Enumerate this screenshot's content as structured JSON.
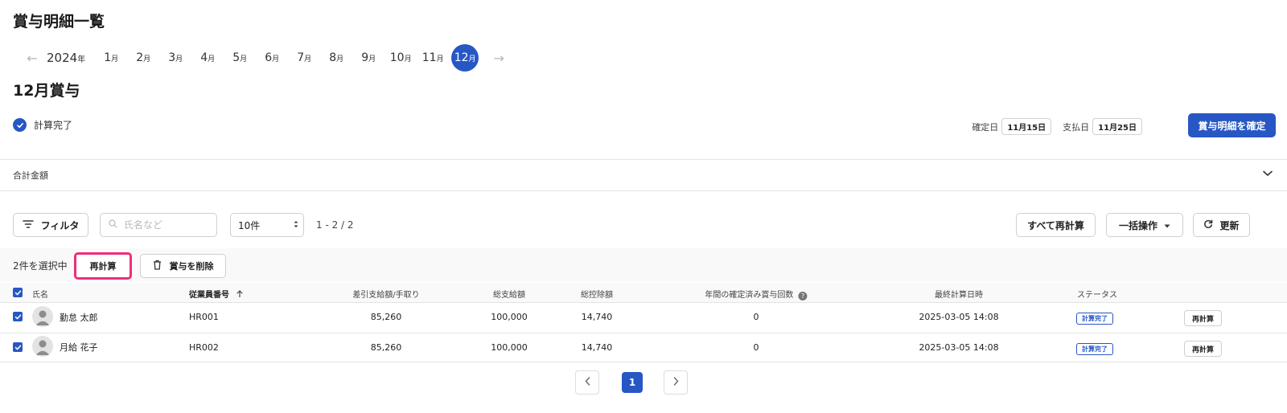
{
  "page": {
    "title": "賞与明細一覧"
  },
  "month_nav": {
    "year": "2024",
    "year_suffix": "年",
    "month_suffix": "月",
    "months": [
      "1",
      "2",
      "3",
      "4",
      "5",
      "6",
      "7",
      "8",
      "9",
      "10",
      "11",
      "12"
    ],
    "selected_month": "12"
  },
  "section": {
    "title": "12月賞与"
  },
  "status": {
    "label": "計算完了"
  },
  "dates": {
    "confirm_label": "確定日",
    "confirm_value": "11月15日",
    "payment_label": "支払日",
    "payment_value": "11月25日"
  },
  "confirm_button": {
    "label": "賞与明細を確定"
  },
  "totals": {
    "label": "合計金額"
  },
  "toolbar": {
    "filter_label": "フィルタ",
    "search_placeholder": "氏名など",
    "per_page": "10件",
    "range": "1 - 2 / 2",
    "recalc_all_label": "すべて再計算",
    "bulk_label": "一括操作",
    "refresh_label": "更新"
  },
  "selection": {
    "count_label": "2件を選択中",
    "recalc_label": "再計算",
    "delete_label": "賞与を削除"
  },
  "table": {
    "columns": {
      "name": "氏名",
      "employee_no": "従業員番号",
      "net": "差引支給額/手取り",
      "gross": "総支給額",
      "deduction": "総控除額",
      "confirmed_count": "年間の確定済み賞与回数",
      "last_calc": "最終計算日時",
      "status": "ステータス"
    },
    "rows": [
      {
        "name": "勤怠 太郎",
        "employee_no": "HR001",
        "net": "85,260",
        "gross": "100,000",
        "deduction": "14,740",
        "confirmed_count": "0",
        "last_calc": "2025-03-05 14:08",
        "status": "計算完了",
        "action": "再計算"
      },
      {
        "name": "月給 花子",
        "employee_no": "HR002",
        "net": "85,260",
        "gross": "100,000",
        "deduction": "14,740",
        "confirmed_count": "0",
        "last_calc": "2025-03-05 14:08",
        "status": "計算完了",
        "action": "再計算"
      }
    ]
  },
  "pagination": {
    "current": "1"
  },
  "colors": {
    "primary": "#2757c5",
    "highlight": "#ee2d7a"
  }
}
